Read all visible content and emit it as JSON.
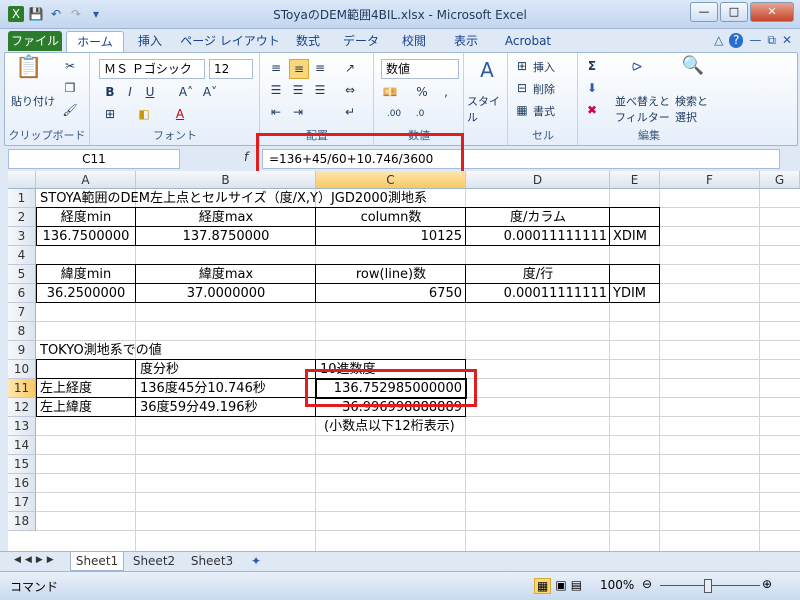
{
  "window": {
    "title": "SToyaのDEM範囲4BIL.xlsx - Microsoft Excel"
  },
  "tabs": [
    "ファイル",
    "ホーム",
    "挿入",
    "ページ レイアウト",
    "数式",
    "データ",
    "校閲",
    "表示",
    "Acrobat"
  ],
  "ribbon": {
    "paste_label": "貼り付け",
    "clipboard_group": "クリップボード",
    "font_name": "ＭＳ Ｐゴシック",
    "font_size": "12",
    "font_group": "フォント",
    "align_group": "配置",
    "number_format": "数値",
    "number_group": "数値",
    "style_label": "スタイル",
    "insert_label": "挿入",
    "delete_label": "削除",
    "format_label": "書式",
    "cell_group": "セル",
    "sort_filter_label1": "並べ替えと",
    "sort_filter_label2": "フィルター",
    "find_label1": "検索と",
    "find_label2": "選択",
    "edit_group": "編集"
  },
  "formula_bar": {
    "name_box": "C11",
    "formula": "=136+45/60+10.746/3600"
  },
  "columns": [
    "A",
    "B",
    "C",
    "D",
    "E",
    "F",
    "G"
  ],
  "rows": [
    "1",
    "2",
    "3",
    "4",
    "5",
    "6",
    "7",
    "8",
    "9",
    "10",
    "11",
    "12",
    "13",
    "14",
    "15",
    "16",
    "17",
    "18"
  ],
  "cells": {
    "r1_title": "STOYA範囲のDEM左上点とセルサイズ（度/X,Y）JGD2000測地系",
    "r2": [
      "経度min",
      "経度max",
      "column数",
      "度/カラム"
    ],
    "r3": [
      "136.7500000",
      "137.8750000",
      "10125",
      "0.00011111111",
      "XDIM"
    ],
    "r5": [
      "緯度min",
      "緯度max",
      "row(line)数",
      "度/行"
    ],
    "r6": [
      "36.2500000",
      "37.0000000",
      "6750",
      "0.00011111111",
      "YDIM"
    ],
    "r9_title": "TOKYO測地系での値",
    "r10": [
      "度分秒",
      "10進数度"
    ],
    "r11": [
      "左上経度",
      "136度45分10.746秒",
      "136.752985000000"
    ],
    "r12": [
      "左上緯度",
      "36度59分49.196秒",
      "36.996998888889"
    ],
    "r13_note": "(小数点以下12桁表示)"
  },
  "sheets": [
    "Sheet1",
    "Sheet2",
    "Sheet3"
  ],
  "status": {
    "mode": "コマンド",
    "zoom": "100%"
  },
  "colors": {
    "highlight": "#e01e1e",
    "file_tab": "#2b7d2b"
  }
}
